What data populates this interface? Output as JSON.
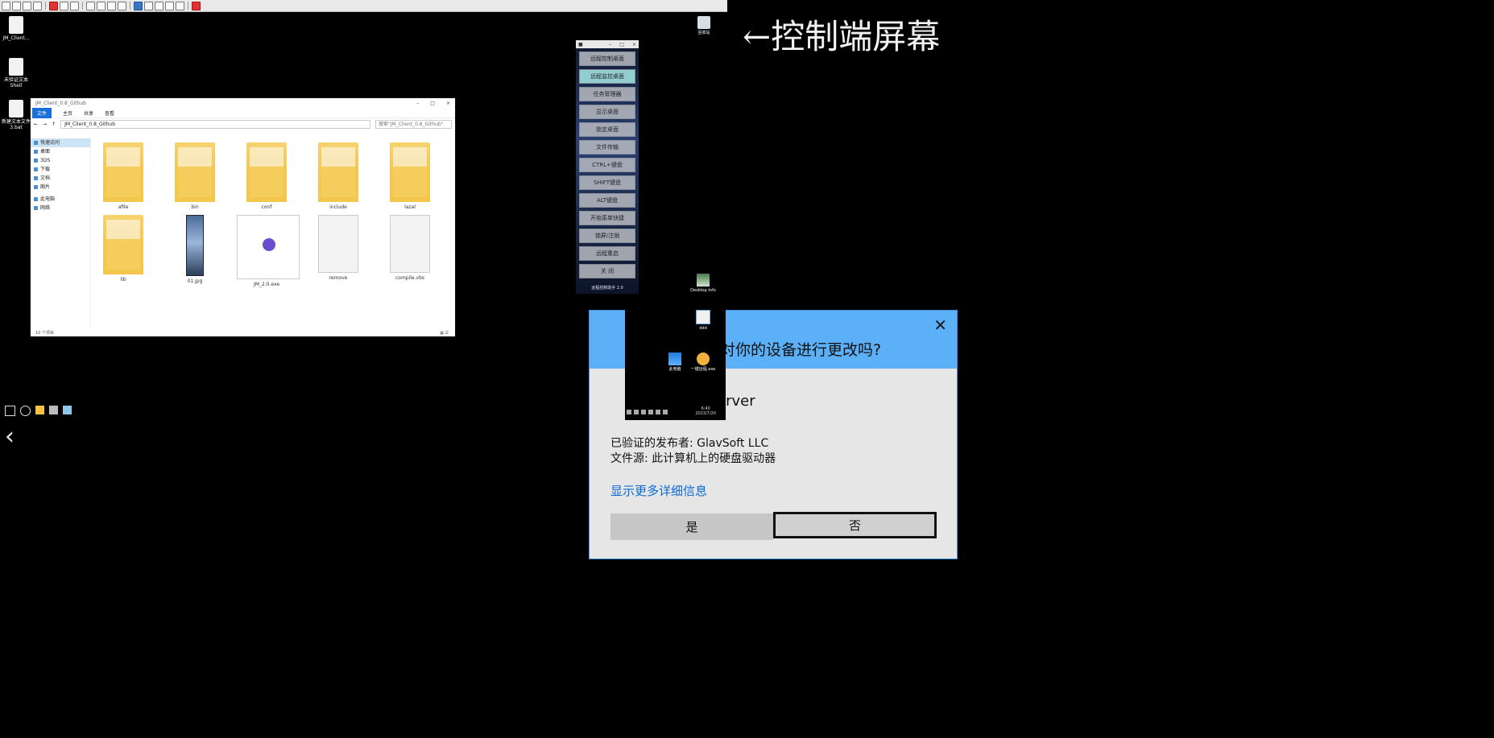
{
  "caption": "←控制端屏幕",
  "desktop_left": {
    "icons": [
      {
        "label": "JM_Client..."
      },
      {
        "label": "未验证文本 Shell"
      },
      {
        "label": "新建文本文件 3.bat"
      }
    ]
  },
  "explorer": {
    "title": "JM_Client_0.8_Github",
    "ribbon": [
      "文件",
      "主页",
      "共享",
      "查看"
    ],
    "address": "JM_Client_0.8_Github",
    "search_placeholder": "搜索\"JM_Client_0.8_Github\"",
    "nav": [
      "快速访问",
      "桌面",
      "3DS",
      "下载",
      "文档",
      "图片",
      "此电脑",
      "网络"
    ],
    "files": [
      "afile",
      "bin",
      "conf",
      "include",
      "lazal",
      "lib",
      "01.jpg",
      "JM_2.0.exe",
      "remove",
      "compile.vbs"
    ],
    "status": "10 个项目"
  },
  "panel": {
    "buttons": [
      "远程控制桌面",
      "远程监控桌面",
      "任务管理器",
      "显示桌面",
      "锁定桌面",
      "文件传输",
      "CTRL+键盘",
      "SHIFT键盘",
      "ALT键盘",
      "开始菜单快捷",
      "锁屏/注销",
      "远程重启",
      "关 闭"
    ],
    "footer": "远程控制助手 2.0"
  },
  "desktop_right": {
    "recycle": "回收站",
    "desktop_info": "Desktop Info",
    "doc": "ddd",
    "pc": "此电脑",
    "oneclick": "一键远程.exe"
  },
  "remote_clock": {
    "time": "6:40",
    "date": "2023/7/20"
  },
  "uac": {
    "question": "对你的设备进行更改吗?",
    "app": "erver",
    "publisher": "已验证的发布者: GlavSoft LLC",
    "source": "文件源: 此计算机上的硬盘驱动器",
    "details": "显示更多详细信息",
    "yes": "是",
    "no": "否"
  }
}
